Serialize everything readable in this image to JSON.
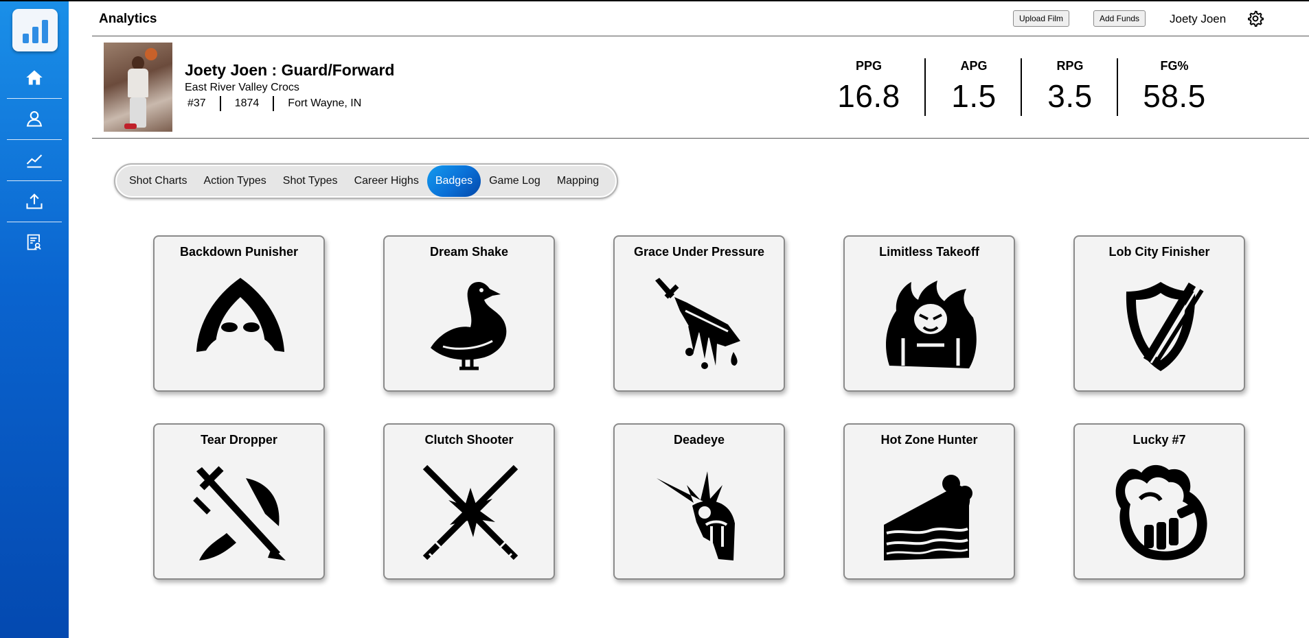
{
  "app": {
    "title": "Analytics"
  },
  "header": {
    "upload_label": "Upload Film",
    "funds_label": "Add Funds",
    "user_name": "Joety Joen"
  },
  "sidebar": {
    "items": [
      {
        "icon": "home-icon"
      },
      {
        "icon": "profile-icon"
      },
      {
        "icon": "chart-icon"
      },
      {
        "icon": "upload-icon"
      },
      {
        "icon": "report-icon"
      }
    ],
    "accent": "#0a64cf"
  },
  "player": {
    "name": "Joety Joen : Guard/Forward",
    "team": "East River Valley Crocs",
    "number": "#37",
    "id": "1874",
    "hometown": "Fort Wayne, IN"
  },
  "stats": [
    {
      "label": "PPG",
      "value": "16.8"
    },
    {
      "label": "APG",
      "value": "1.5"
    },
    {
      "label": "RPG",
      "value": "3.5"
    },
    {
      "label": "FG%",
      "value": "58.5"
    }
  ],
  "tabs": [
    {
      "label": "Shot Charts"
    },
    {
      "label": "Action Types"
    },
    {
      "label": "Shot Types"
    },
    {
      "label": "Career Highs"
    },
    {
      "label": "Badges",
      "active": true
    },
    {
      "label": "Game Log"
    },
    {
      "label": "Mapping"
    }
  ],
  "badges": [
    {
      "title": "Backdown Punisher",
      "icon": "hood-icon"
    },
    {
      "title": "Dream Shake",
      "icon": "duck-icon"
    },
    {
      "title": "Grace Under Pressure",
      "icon": "bleeding-blade-icon"
    },
    {
      "title": "Limitless Takeoff",
      "icon": "fire-demon-icon"
    },
    {
      "title": "Lob City Finisher",
      "icon": "slashed-shield-icon"
    },
    {
      "title": "Tear Dropper",
      "icon": "axe-sword-icon"
    },
    {
      "title": "Clutch Shooter",
      "icon": "crossed-lightsabers-icon"
    },
    {
      "title": "Deadeye",
      "icon": "helmet-impact-icon"
    },
    {
      "title": "Hot Zone Hunter",
      "icon": "cake-slice-icon"
    },
    {
      "title": "Lucky #7",
      "icon": "flaming-fist-icon"
    }
  ]
}
